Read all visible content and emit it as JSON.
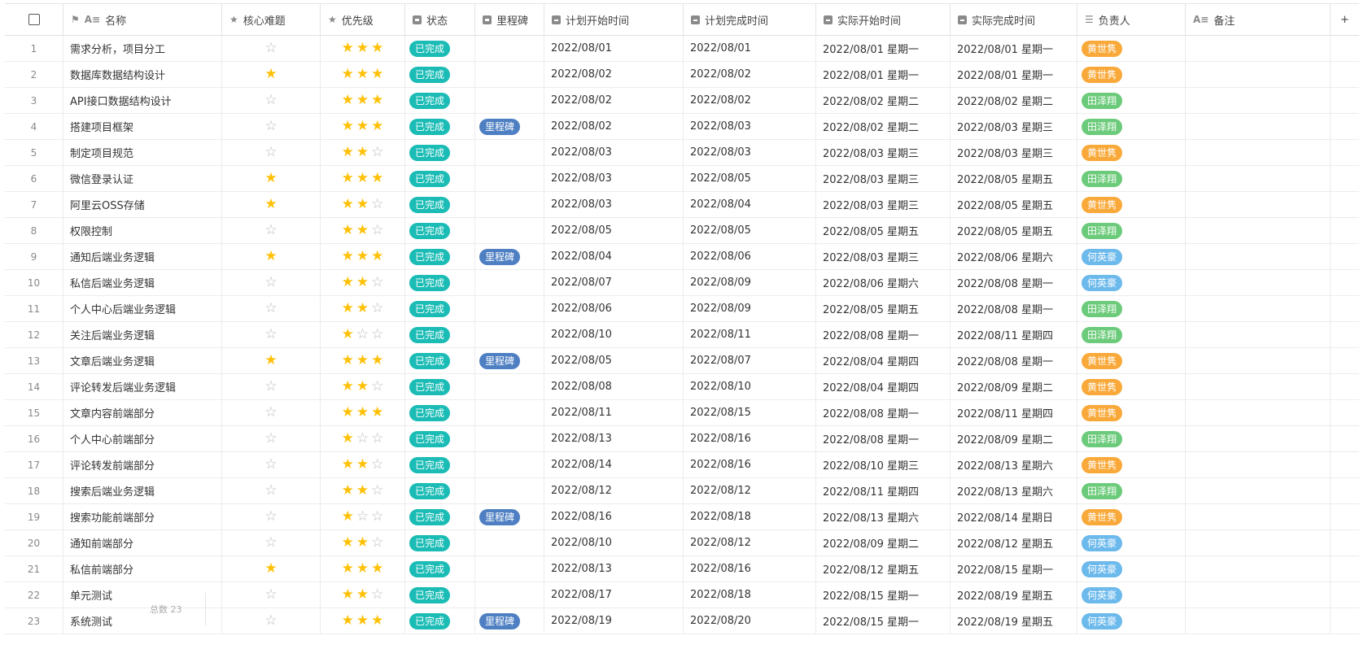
{
  "headers": {
    "name": "名称",
    "core": "核心难题",
    "priority": "优先级",
    "status": "状态",
    "milestone": "里程碑",
    "plan_start": "计划开始时间",
    "plan_end": "计划完成时间",
    "actual_start": "实际开始时间",
    "actual_end": "实际完成时间",
    "owner": "负责人",
    "note": "备注",
    "add_column": "+"
  },
  "colors": {
    "status_done": "#1bbcb5",
    "milestone": "#4e7fc2",
    "owner_huang": "#f9a93a",
    "owner_tian": "#6ccb7a",
    "owner_he": "#6cb9ec",
    "star_on": "#ffc107",
    "star_off": "#b9b9b9"
  },
  "footer": {
    "count": "总数 23"
  },
  "rows": [
    {
      "idx": "1",
      "name": "需求分析，项目分工",
      "core": false,
      "priority": 3,
      "status": "已完成",
      "milestone": "",
      "plan_start": "2022/08/01",
      "plan_end": "2022/08/01",
      "actual_start": "2022/08/01 星期一",
      "actual_end": "2022/08/01 星期一",
      "owner": "黄世隽",
      "owner_color": "huang"
    },
    {
      "idx": "2",
      "name": "数据库数据结构设计",
      "core": true,
      "priority": 3,
      "status": "已完成",
      "milestone": "",
      "plan_start": "2022/08/02",
      "plan_end": "2022/08/02",
      "actual_start": "2022/08/01 星期一",
      "actual_end": "2022/08/01 星期一",
      "owner": "黄世隽",
      "owner_color": "huang"
    },
    {
      "idx": "3",
      "name": "API接口数据结构设计",
      "core": false,
      "priority": 3,
      "status": "已完成",
      "milestone": "",
      "plan_start": "2022/08/02",
      "plan_end": "2022/08/02",
      "actual_start": "2022/08/02 星期二",
      "actual_end": "2022/08/02 星期二",
      "owner": "田泽翔",
      "owner_color": "tian"
    },
    {
      "idx": "4",
      "name": "搭建项目框架",
      "core": false,
      "priority": 3,
      "status": "已完成",
      "milestone": "里程碑",
      "plan_start": "2022/08/02",
      "plan_end": "2022/08/03",
      "actual_start": "2022/08/02 星期二",
      "actual_end": "2022/08/03 星期三",
      "owner": "田泽翔",
      "owner_color": "tian"
    },
    {
      "idx": "5",
      "name": "制定项目规范",
      "core": false,
      "priority": 2,
      "status": "已完成",
      "milestone": "",
      "plan_start": "2022/08/03",
      "plan_end": "2022/08/03",
      "actual_start": "2022/08/03 星期三",
      "actual_end": "2022/08/03 星期三",
      "owner": "黄世隽",
      "owner_color": "huang"
    },
    {
      "idx": "6",
      "name": "微信登录认证",
      "core": true,
      "priority": 3,
      "status": "已完成",
      "milestone": "",
      "plan_start": "2022/08/03",
      "plan_end": "2022/08/05",
      "actual_start": "2022/08/03 星期三",
      "actual_end": "2022/08/05 星期五",
      "owner": "田泽翔",
      "owner_color": "tian"
    },
    {
      "idx": "7",
      "name": "阿里云OSS存储",
      "core": true,
      "priority": 2,
      "status": "已完成",
      "milestone": "",
      "plan_start": "2022/08/03",
      "plan_end": "2022/08/04",
      "actual_start": "2022/08/03 星期三",
      "actual_end": "2022/08/05 星期五",
      "owner": "黄世隽",
      "owner_color": "huang"
    },
    {
      "idx": "8",
      "name": "权限控制",
      "core": false,
      "priority": 2,
      "status": "已完成",
      "milestone": "",
      "plan_start": "2022/08/05",
      "plan_end": "2022/08/05",
      "actual_start": "2022/08/05 星期五",
      "actual_end": "2022/08/05 星期五",
      "owner": "田泽翔",
      "owner_color": "tian"
    },
    {
      "idx": "9",
      "name": "通知后端业务逻辑",
      "core": true,
      "priority": 3,
      "status": "已完成",
      "milestone": "里程碑",
      "plan_start": "2022/08/04",
      "plan_end": "2022/08/06",
      "actual_start": "2022/08/03 星期三",
      "actual_end": "2022/08/06 星期六",
      "owner": "何英豪",
      "owner_color": "he"
    },
    {
      "idx": "10",
      "name": "私信后端业务逻辑",
      "core": false,
      "priority": 2,
      "status": "已完成",
      "milestone": "",
      "plan_start": "2022/08/07",
      "plan_end": "2022/08/09",
      "actual_start": "2022/08/06 星期六",
      "actual_end": "2022/08/08 星期一",
      "owner": "何英豪",
      "owner_color": "he"
    },
    {
      "idx": "11",
      "name": "个人中心后端业务逻辑",
      "core": false,
      "priority": 2,
      "status": "已完成",
      "milestone": "",
      "plan_start": "2022/08/06",
      "plan_end": "2022/08/09",
      "actual_start": "2022/08/05 星期五",
      "actual_end": "2022/08/08 星期一",
      "owner": "田泽翔",
      "owner_color": "tian"
    },
    {
      "idx": "12",
      "name": "关注后端业务逻辑",
      "core": false,
      "priority": 1,
      "status": "已完成",
      "milestone": "",
      "plan_start": "2022/08/10",
      "plan_end": "2022/08/11",
      "actual_start": "2022/08/08 星期一",
      "actual_end": "2022/08/11 星期四",
      "owner": "田泽翔",
      "owner_color": "tian"
    },
    {
      "idx": "13",
      "name": "文章后端业务逻辑",
      "core": true,
      "priority": 3,
      "status": "已完成",
      "milestone": "里程碑",
      "plan_start": "2022/08/05",
      "plan_end": "2022/08/07",
      "actual_start": "2022/08/04 星期四",
      "actual_end": "2022/08/08 星期一",
      "owner": "黄世隽",
      "owner_color": "huang"
    },
    {
      "idx": "14",
      "name": "评论转发后端业务逻辑",
      "core": false,
      "priority": 2,
      "status": "已完成",
      "milestone": "",
      "plan_start": "2022/08/08",
      "plan_end": "2022/08/10",
      "actual_start": "2022/08/04 星期四",
      "actual_end": "2022/08/09 星期二",
      "owner": "黄世隽",
      "owner_color": "huang"
    },
    {
      "idx": "15",
      "name": "文章内容前端部分",
      "core": false,
      "priority": 3,
      "status": "已完成",
      "milestone": "",
      "plan_start": "2022/08/11",
      "plan_end": "2022/08/15",
      "actual_start": "2022/08/08 星期一",
      "actual_end": "2022/08/11 星期四",
      "owner": "黄世隽",
      "owner_color": "huang"
    },
    {
      "idx": "16",
      "name": "个人中心前端部分",
      "core": false,
      "priority": 1,
      "status": "已完成",
      "milestone": "",
      "plan_start": "2022/08/13",
      "plan_end": "2022/08/16",
      "actual_start": "2022/08/08 星期一",
      "actual_end": "2022/08/09 星期二",
      "owner": "田泽翔",
      "owner_color": "tian"
    },
    {
      "idx": "17",
      "name": "评论转发前端部分",
      "core": false,
      "priority": 2,
      "status": "已完成",
      "milestone": "",
      "plan_start": "2022/08/14",
      "plan_end": "2022/08/16",
      "actual_start": "2022/08/10 星期三",
      "actual_end": "2022/08/13 星期六",
      "owner": "黄世隽",
      "owner_color": "huang"
    },
    {
      "idx": "18",
      "name": "搜索后端业务逻辑",
      "core": false,
      "priority": 2,
      "status": "已完成",
      "milestone": "",
      "plan_start": "2022/08/12",
      "plan_end": "2022/08/12",
      "actual_start": "2022/08/11 星期四",
      "actual_end": "2022/08/13 星期六",
      "owner": "田泽翔",
      "owner_color": "tian"
    },
    {
      "idx": "19",
      "name": "搜索功能前端部分",
      "core": false,
      "priority": 1,
      "status": "已完成",
      "milestone": "里程碑",
      "plan_start": "2022/08/16",
      "plan_end": "2022/08/18",
      "actual_start": "2022/08/13 星期六",
      "actual_end": "2022/08/14 星期日",
      "owner": "黄世隽",
      "owner_color": "huang"
    },
    {
      "idx": "20",
      "name": "通知前端部分",
      "core": false,
      "priority": 2,
      "status": "已完成",
      "milestone": "",
      "plan_start": "2022/08/10",
      "plan_end": "2022/08/12",
      "actual_start": "2022/08/09 星期二",
      "actual_end": "2022/08/12 星期五",
      "owner": "何英豪",
      "owner_color": "he"
    },
    {
      "idx": "21",
      "name": "私信前端部分",
      "core": true,
      "priority": 3,
      "status": "已完成",
      "milestone": "",
      "plan_start": "2022/08/13",
      "plan_end": "2022/08/16",
      "actual_start": "2022/08/12 星期五",
      "actual_end": "2022/08/15 星期一",
      "owner": "何英豪",
      "owner_color": "he"
    },
    {
      "idx": "22",
      "name": "单元测试",
      "core": false,
      "priority": 2,
      "status": "已完成",
      "milestone": "",
      "plan_start": "2022/08/17",
      "plan_end": "2022/08/18",
      "actual_start": "2022/08/15 星期一",
      "actual_end": "2022/08/19 星期五",
      "owner": "何英豪",
      "owner_color": "he"
    },
    {
      "idx": "23",
      "name": "系统测试",
      "core": false,
      "priority": 3,
      "status": "已完成",
      "milestone": "里程碑",
      "plan_start": "2022/08/19",
      "plan_end": "2022/08/20",
      "actual_start": "2022/08/15 星期一",
      "actual_end": "2022/08/19 星期五",
      "owner": "何英豪",
      "owner_color": "he"
    }
  ]
}
